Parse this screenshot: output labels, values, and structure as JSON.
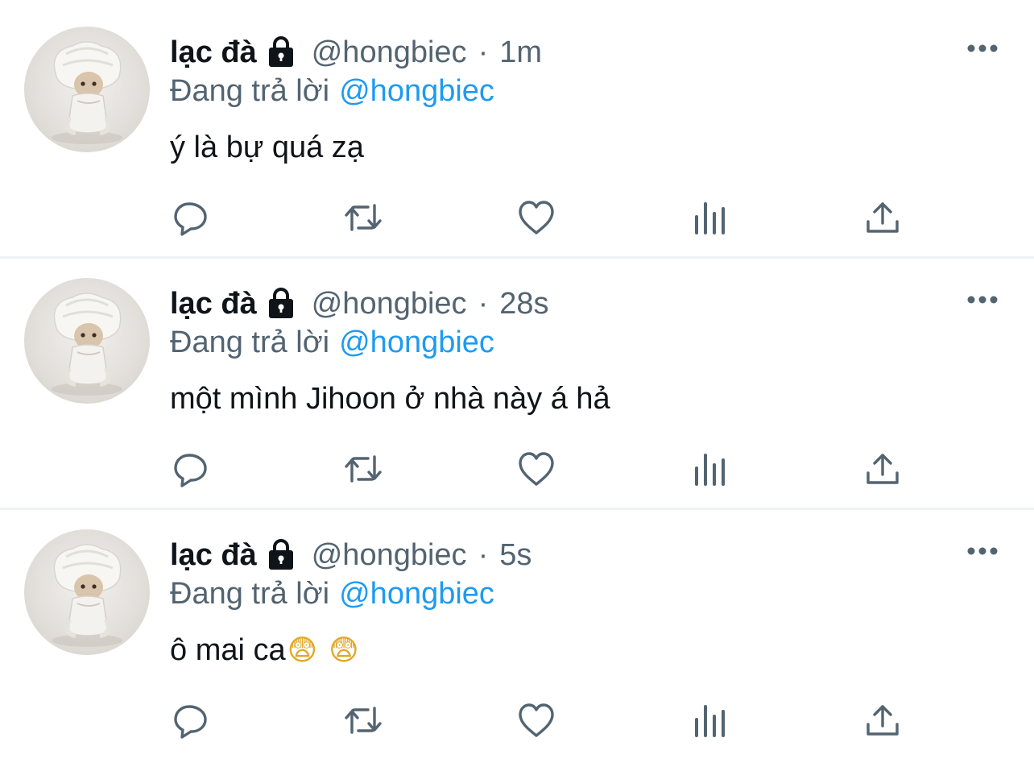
{
  "colors": {
    "text_primary": "#0f1419",
    "text_secondary": "#536471",
    "link": "#1d9bf0",
    "divider": "#eff3f4"
  },
  "tweets": [
    {
      "display_name": "lạc đà",
      "handle": "@hongbiec",
      "separator": "·",
      "time": "1m",
      "reply_label": "Đang trả lời",
      "reply_to": "@hongbiec",
      "text": "ý là bự quá zạ",
      "emojis": [],
      "icons": [
        "lock-icon",
        "more-icon",
        "reply-icon",
        "retweet-icon",
        "like-icon",
        "views-icon",
        "share-icon"
      ]
    },
    {
      "display_name": "lạc đà",
      "handle": "@hongbiec",
      "separator": "·",
      "time": "28s",
      "reply_label": "Đang trả lời",
      "reply_to": "@hongbiec",
      "text": "một mình Jihoon ở nhà này á hả",
      "emojis": [],
      "icons": [
        "lock-icon",
        "more-icon",
        "reply-icon",
        "retweet-icon",
        "like-icon",
        "views-icon",
        "share-icon"
      ]
    },
    {
      "display_name": "lạc đà",
      "handle": "@hongbiec",
      "separator": "·",
      "time": "5s",
      "reply_label": "Đang trả lời",
      "reply_to": "@hongbiec",
      "text": "ô mai ca",
      "emojis": [
        "😨",
        "😨"
      ],
      "icons": [
        "lock-icon",
        "more-icon",
        "reply-icon",
        "retweet-icon",
        "like-icon",
        "views-icon",
        "share-icon"
      ]
    }
  ]
}
